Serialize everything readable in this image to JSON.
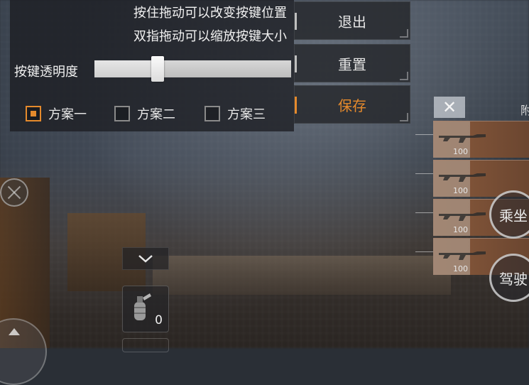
{
  "panel": {
    "hint_drag": "按住拖动可以改变按键位置",
    "hint_pinch": "双指拖动可以缩放按键大小",
    "opacity_label": "按键透明度",
    "opacity_value": 0.32,
    "schemes": [
      {
        "label": "方案一",
        "checked": true
      },
      {
        "label": "方案二",
        "checked": false
      },
      {
        "label": "方案三",
        "checked": false
      }
    ]
  },
  "buttons": {
    "exit": "退出",
    "reset": "重置",
    "save": "保存"
  },
  "items": {
    "close_icon": "close-icon",
    "header_fragment": "附",
    "weapons": [
      {
        "ammo": "100"
      },
      {
        "ammo": "100"
      },
      {
        "ammo": "100"
      },
      {
        "ammo": "100"
      }
    ]
  },
  "actions": {
    "ride": "乘坐",
    "drive": "驾驶"
  },
  "hud": {
    "grenade_count": "0"
  },
  "colors": {
    "accent": "#e58a2c",
    "panel_bg": "#1c1e23"
  }
}
